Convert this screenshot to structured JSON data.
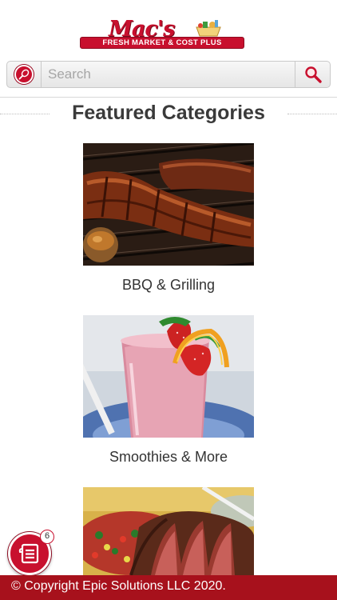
{
  "brand": {
    "logo_text": "Mac's",
    "tagline": "FRESH MARKET & COST PLUS",
    "accent_color": "#c8102e",
    "footer_color": "#a7111c"
  },
  "search": {
    "placeholder": "Search",
    "value": "",
    "menu_icon": "whisk-icon",
    "search_icon": "magnifier-icon"
  },
  "section": {
    "title": "Featured Categories"
  },
  "categories": [
    {
      "label": "BBQ & Grilling",
      "image": "grilled-ribs-photo"
    },
    {
      "label": "Smoothies & More",
      "image": "strawberry-smoothie-photo"
    },
    {
      "label": "",
      "image": "sliced-steak-photo"
    }
  ],
  "shopping_list": {
    "icon": "list-icon",
    "badge_count": "6"
  },
  "footer": {
    "text": "© Copyright Epic Solutions LLC 2020."
  }
}
